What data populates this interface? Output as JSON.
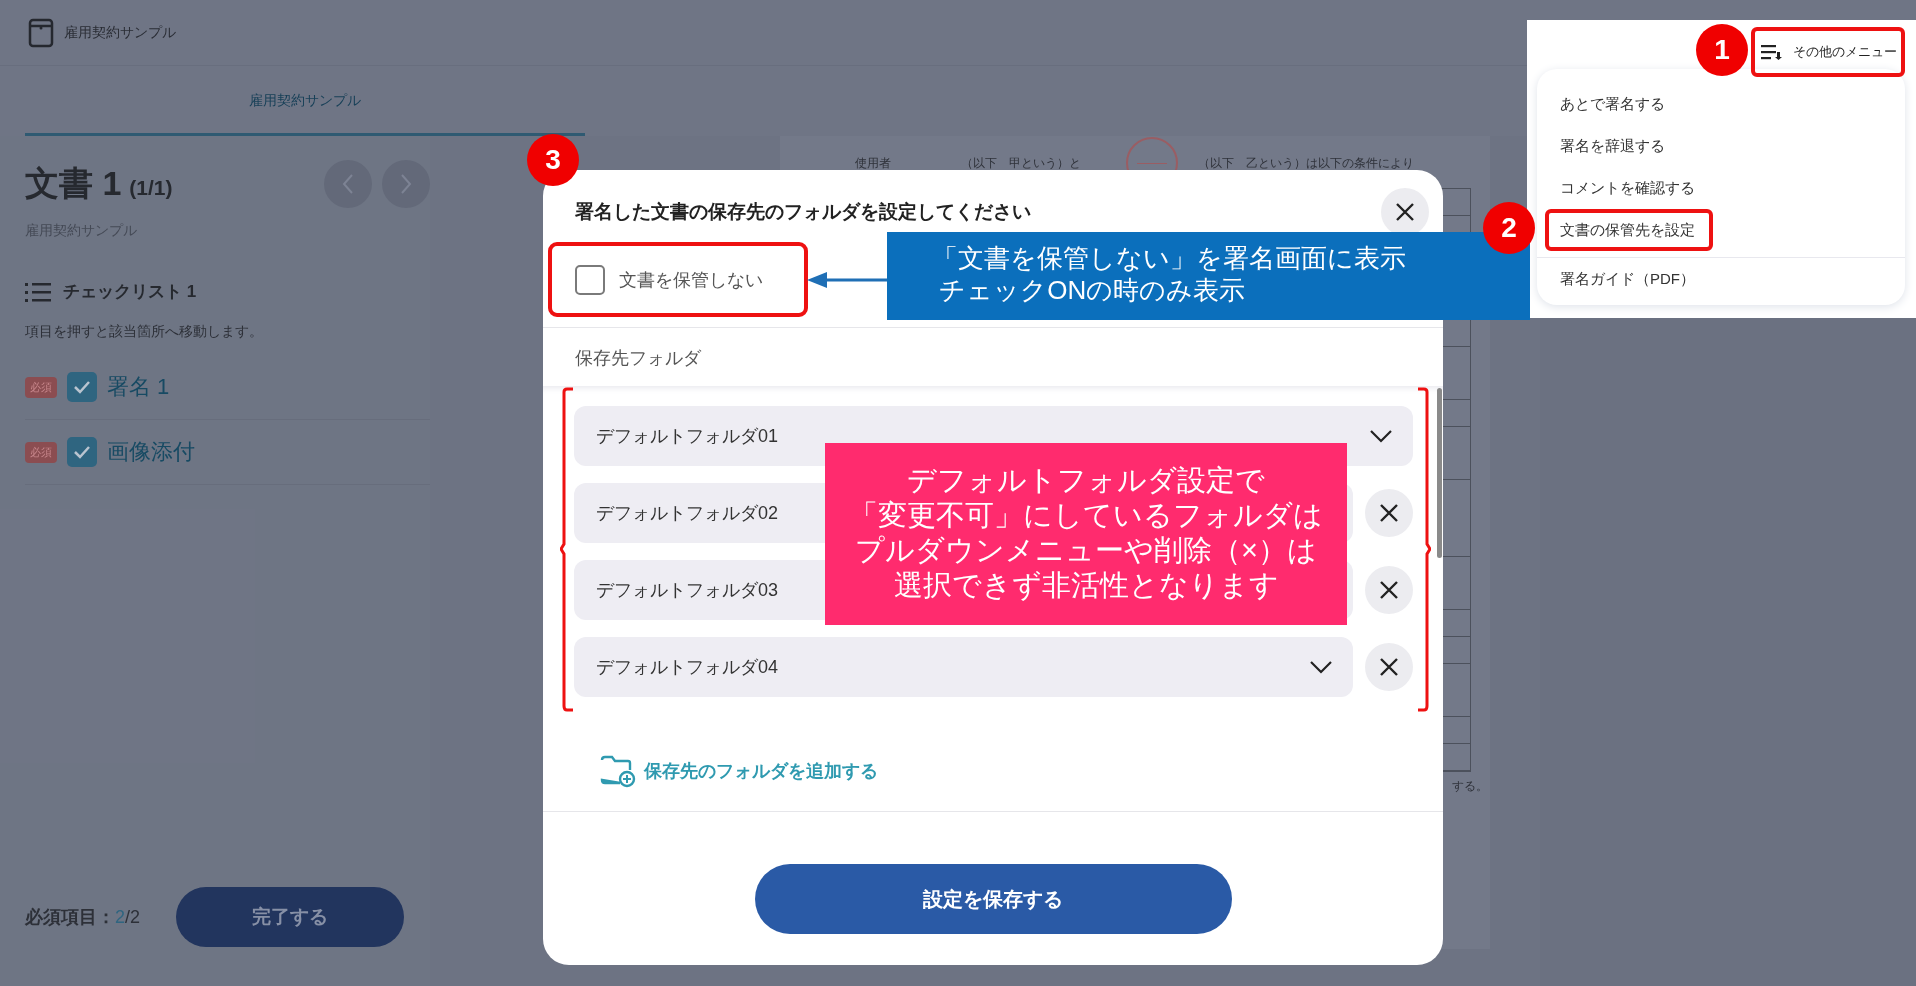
{
  "header": {
    "title": "雇用契約サンプル"
  },
  "tabs": [
    {
      "label": "雇用契約サンプル",
      "selected": true
    }
  ],
  "sidebar": {
    "doc_title": "文書 1",
    "doc_count": "(1/1)",
    "doc_subtitle": "雇用契約サンプル",
    "checklist_title": "チェックリスト 1",
    "checklist_hint": "項目を押すと該当箇所へ移動します。",
    "items": [
      {
        "tag": "必須",
        "label": "署名 1",
        "checked": true
      },
      {
        "tag": "必須",
        "label": "画像添付",
        "checked": true
      }
    ],
    "required_label": "必須項目：",
    "required_done": "2",
    "required_total": "/2",
    "complete_button": "完了する"
  },
  "document": {
    "line": [
      "使用者",
      "（以下　甲という）と",
      "（以下　乙という）は以下の条件により"
    ],
    "footer": "する。"
  },
  "modal": {
    "title": "署名した文書の保存先のフォルダを設定してください",
    "no_store": {
      "label": "文書を保管しない",
      "checked": false,
      "framed": true
    },
    "folder_heading": "保存先フォルダ",
    "folders_bracketed": true,
    "folders": [
      {
        "name": "デフォルトフォルダ01",
        "dropdown": true,
        "removable": false
      },
      {
        "name": "デフォルトフォルダ02",
        "dropdown": false,
        "removable": true
      },
      {
        "name": "デフォルトフォルダ03",
        "dropdown": false,
        "removable": true
      },
      {
        "name": "デフォルトフォルダ04",
        "dropdown": true,
        "removable": true
      }
    ],
    "add_link": "保存先のフォルダを追加する",
    "save_button": "設定を保存する"
  },
  "menu": {
    "button": "その他のメニュー",
    "button_framed": true,
    "items": [
      {
        "label": "あとで署名する",
        "separated": false,
        "framed": false
      },
      {
        "label": "署名を辞退する",
        "separated": false,
        "framed": false
      },
      {
        "label": "コメントを確認する",
        "separated": false,
        "framed": false
      },
      {
        "label": "文書の保管先を設定",
        "separated": false,
        "framed": true
      },
      {
        "label": "署名ガイド（PDF）",
        "separated": true,
        "framed": false
      }
    ]
  },
  "annotations": {
    "badges": [
      "1",
      "2",
      "3"
    ],
    "callouts": [
      {
        "kind": "blue",
        "lines": [
          "「文書を保管しない」を署名画面に表示",
          " チェックONの時のみ表示"
        ]
      },
      {
        "kind": "pink",
        "lines": [
          "デフォルトフォルダ設定で",
          "「変更不可」にしているフォルダは",
          "プルダウンメニューや削除（×）は",
          "選択できず非活性となります"
        ]
      }
    ]
  }
}
